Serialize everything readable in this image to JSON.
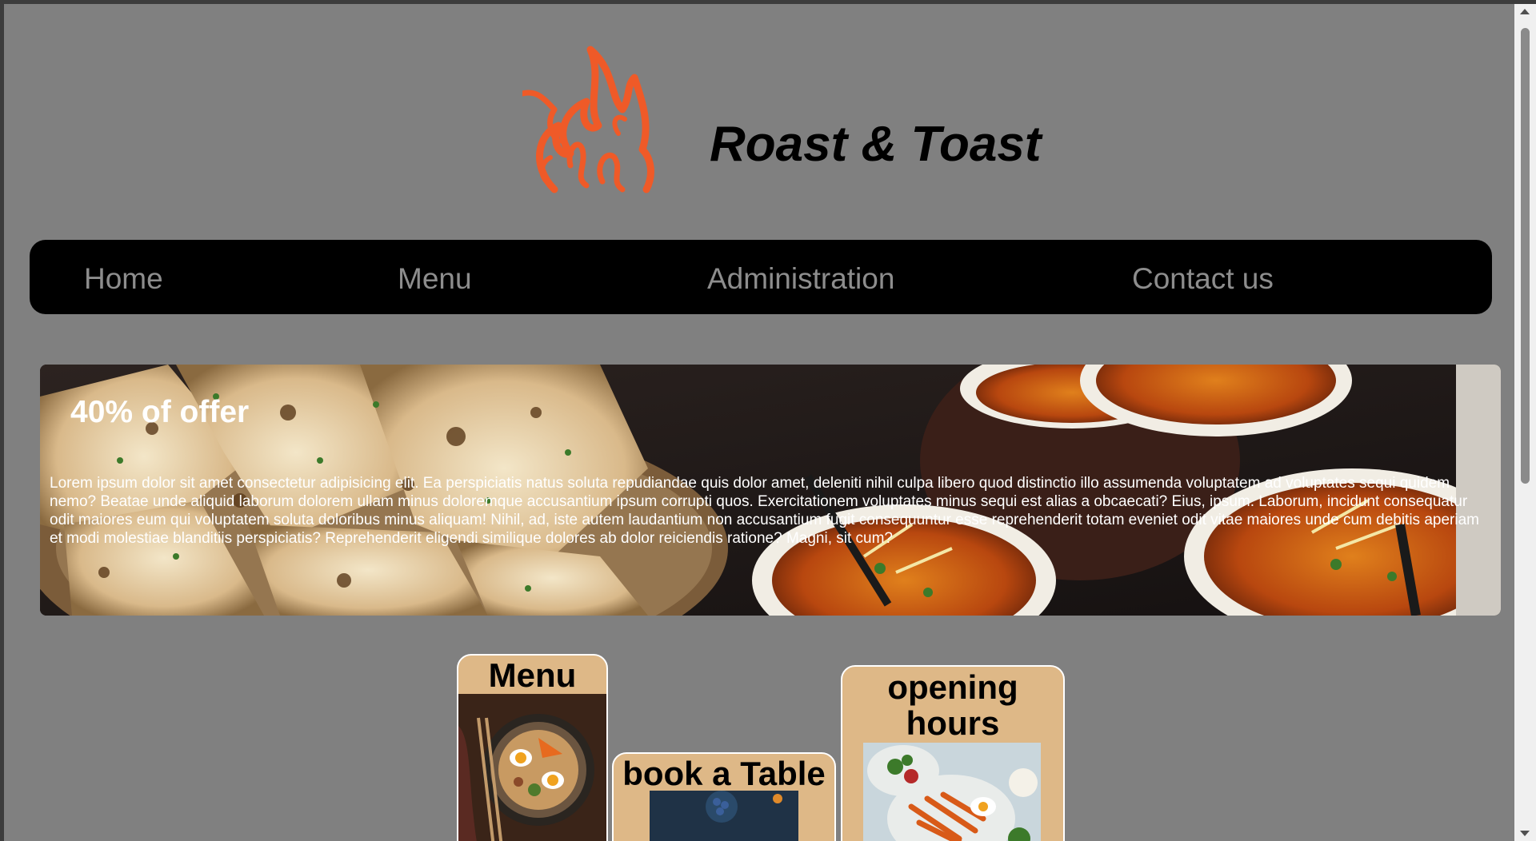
{
  "brand": {
    "name": "Roast & Toast",
    "logo_icon": "flame-icon",
    "logo_color": "#ef5a28"
  },
  "nav": {
    "items": [
      {
        "label": "Home"
      },
      {
        "label": "Menu"
      },
      {
        "label": "Administration"
      },
      {
        "label": "Contact us"
      }
    ]
  },
  "banner": {
    "title": "40% of offer",
    "text": "Lorem ipsum dolor sit amet consectetur adipisicing elit. Ea perspiciatis natus soluta repudiandae quis dolor amet, deleniti nihil culpa libero quod distinctio illo assumenda voluptatem ad voluptates sequi quidem nemo? Beatae unde aliquid laborum dolorem ullam minus doloremque accusantium ipsum corrupti quos. Exercitationem voluptates minus sequi est alias a obcaecati? Eius, ipsum. Laborum, incidunt consequatur odit maiores eum qui voluptatem soluta doloribus minus aliquam! Nihil, ad, iste autem laudantium non accusantium fugit consequuntur esse reprehenderit totam eveniet odit vitae maiores unde cum debitis aperiam et modi molestiae blanditiis perspiciatis? Reprehenderit eligendi similique dolores ab dolor reiciendis ratione? Magni, sit cum?"
  },
  "cards": {
    "menu": {
      "title": "Menu"
    },
    "book": {
      "title": "book a Table"
    },
    "hours": {
      "title": "opening hours"
    }
  },
  "colors": {
    "page_bg": "#808080",
    "nav_bg": "#000000",
    "nav_text": "#8d8d8d",
    "card_bg": "#deb887"
  }
}
